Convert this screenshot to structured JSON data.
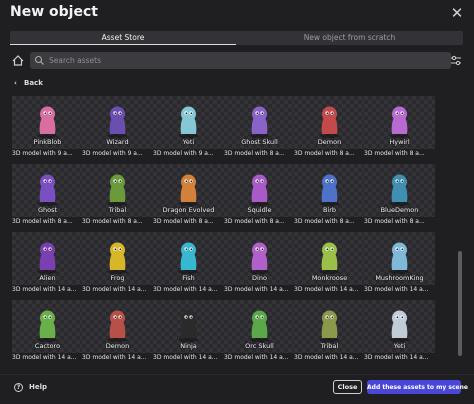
{
  "dialog": {
    "title": "New object"
  },
  "tabs": [
    {
      "label": "Asset Store",
      "active": true
    },
    {
      "label": "New object from scratch",
      "active": false
    }
  ],
  "search": {
    "placeholder": "Search assets",
    "value": ""
  },
  "back_label": "Back",
  "assets": [
    {
      "name": "PinkBlob",
      "desc": "3D model with 9 a...",
      "color": "#d86fa0",
      "icon": "blob-creature"
    },
    {
      "name": "Wizard",
      "desc": "3D model with 9 a...",
      "color": "#6b4fb0",
      "icon": "wizard-creature"
    },
    {
      "name": "Yeti",
      "desc": "3D model with 9 a...",
      "color": "#86c7d6",
      "icon": "yeti-creature"
    },
    {
      "name": "Ghost Skull",
      "desc": "3D model with 8 a...",
      "color": "#8a63c8",
      "icon": "ghost-creature"
    },
    {
      "name": "Demon",
      "desc": "3D model with 8 a...",
      "color": "#c24a4a",
      "icon": "demon-creature"
    },
    {
      "name": "Hywirl",
      "desc": "3D model with 8 a...",
      "color": "#b86ad0",
      "icon": "hywirl-creature"
    },
    {
      "name": "Ghost",
      "desc": "3D model with 8 a...",
      "color": "#7a4fc2",
      "icon": "ghost-creature"
    },
    {
      "name": "Tribal",
      "desc": "3D model with 8 a...",
      "color": "#6a9a3a",
      "icon": "tribal-creature"
    },
    {
      "name": "Dragon Evolved",
      "desc": "3D model with 8 a...",
      "color": "#d2803a",
      "icon": "dragon-creature"
    },
    {
      "name": "Squidle",
      "desc": "3D model with 8 a...",
      "color": "#a75ac8",
      "icon": "squid-creature"
    },
    {
      "name": "Birb",
      "desc": "3D model with 8 a...",
      "color": "#4d72c8",
      "icon": "bird-creature"
    },
    {
      "name": "BlueDemon",
      "desc": "3D model with 8 a...",
      "color": "#3e8fb0",
      "icon": "demon-creature"
    },
    {
      "name": "Alien",
      "desc": "3D model with 14 a...",
      "color": "#7a3fb0",
      "icon": "alien-creature"
    },
    {
      "name": "Frog",
      "desc": "3D model with 14 a...",
      "color": "#d8b62a",
      "icon": "frog-creature"
    },
    {
      "name": "Fish",
      "desc": "3D model with 14 a...",
      "color": "#38b8d0",
      "icon": "fish-creature"
    },
    {
      "name": "Dino",
      "desc": "3D model with 14 a...",
      "color": "#b060c8",
      "icon": "dino-creature"
    },
    {
      "name": "Monkroose",
      "desc": "3D model with 14 a...",
      "color": "#9ac04a",
      "icon": "monk-creature"
    },
    {
      "name": "MushroomKing",
      "desc": "3D model with 14 a...",
      "color": "#7fb8d8",
      "icon": "mushroom-creature"
    },
    {
      "name": "Cactoro",
      "desc": "3D model with 14 a...",
      "color": "#6ab04a",
      "icon": "cactus-creature"
    },
    {
      "name": "Demon",
      "desc": "3D model with 14 a...",
      "color": "#b8504a",
      "icon": "demon-creature"
    },
    {
      "name": "Ninja",
      "desc": "3D model with 14 a...",
      "color": "#2a2a2a",
      "icon": "ninja-creature"
    },
    {
      "name": "Orc Skull",
      "desc": "3D model with 14 a...",
      "color": "#5aa84a",
      "icon": "orc-creature"
    },
    {
      "name": "Tribal",
      "desc": "3D model with 14 a...",
      "color": "#8a9a4a",
      "icon": "tribal-creature"
    },
    {
      "name": "Yeti",
      "desc": "3D model with 14 a...",
      "color": "#c0ccd8",
      "icon": "yeti-creature"
    }
  ],
  "footer": {
    "help_label": "Help",
    "close_label": "Close",
    "add_label": "Add these assets to my scene"
  },
  "colors": {
    "accent": "#4a46d8",
    "background": "#1f1f22"
  }
}
